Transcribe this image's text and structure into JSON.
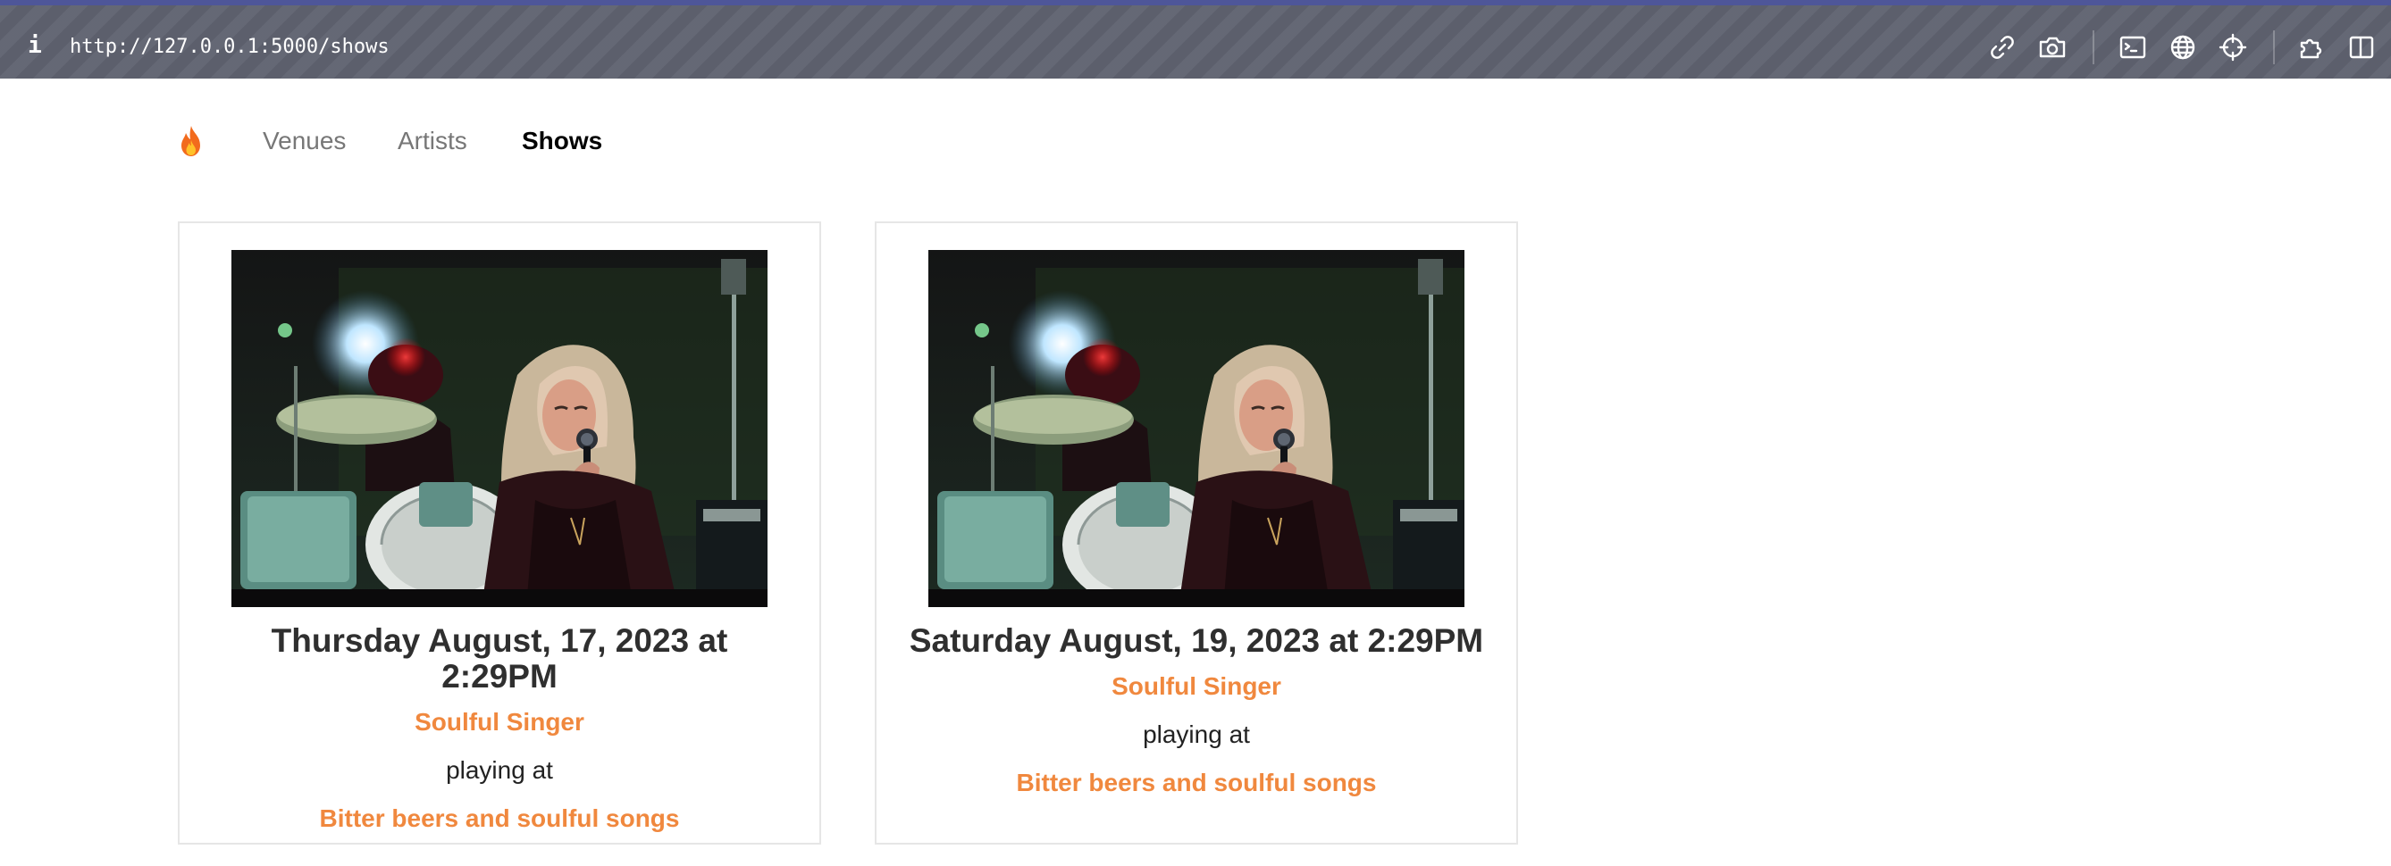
{
  "browser": {
    "url": "http://127.0.0.1:5000/shows",
    "info_glyph": "i",
    "icons": [
      "link-icon",
      "camera-icon",
      "terminal-icon",
      "globe-icon",
      "crosshair-icon",
      "extensions-icon",
      "sidebar-icon"
    ],
    "chrome_color": "#5f6270",
    "accent_color": "#4e5699"
  },
  "nav": {
    "logo_icon": "flame-icon",
    "links": [
      {
        "label": "Venues"
      },
      {
        "label": "Artists"
      },
      {
        "label": "Shows",
        "active": true
      }
    ]
  },
  "shows": [
    {
      "date": "Thursday August, 17, 2023 at 2:29PM",
      "artist": "Soulful Singer",
      "connector": "playing at",
      "venue": "Bitter beers and soulful songs",
      "image": "singer-photo"
    },
    {
      "date": "Saturday August, 19, 2023 at 2:29PM",
      "artist": "Soulful Singer",
      "connector": "playing at",
      "venue": "Bitter beers and soulful songs",
      "image": "singer-photo"
    }
  ],
  "colors": {
    "link": "#f0883e",
    "active_nav": "#000000",
    "nav": "#777777",
    "card_border": "#e6e6e6"
  }
}
